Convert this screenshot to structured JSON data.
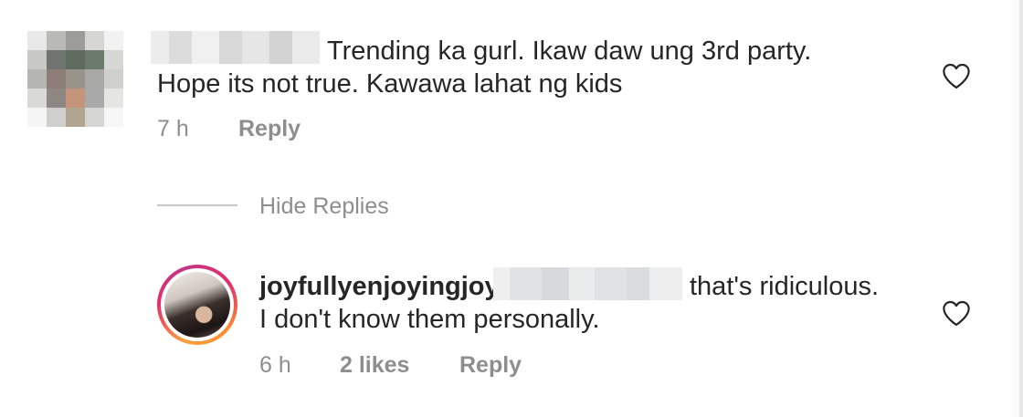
{
  "comments": [
    {
      "text_line1": "Trending ka gurl. Ikaw daw ung 3rd party.",
      "text_line2": "Hope its not true. Kawawa lahat ng kids",
      "time": "7 h",
      "reply_label": "Reply",
      "like_icon": "heart-outline-icon"
    }
  ],
  "replies_toggle": {
    "label": "Hide Replies"
  },
  "replies": [
    {
      "username": "joyfullyenjoyingjoy",
      "text_line1": "that's ridiculous.",
      "text_line2": "I don't know them personally.",
      "time": "6 h",
      "likes_label": "2 likes",
      "reply_label": "Reply",
      "like_icon": "heart-outline-icon"
    }
  ],
  "colors": {
    "text": "#262626",
    "meta": "#8e8e8e",
    "divider": "#c7c7c7"
  }
}
